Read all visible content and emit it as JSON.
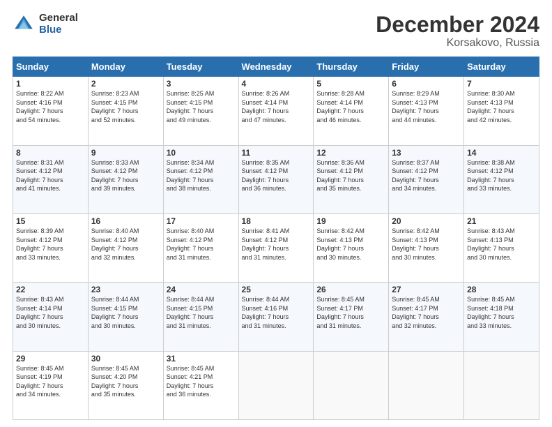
{
  "header": {
    "logo_general": "General",
    "logo_blue": "Blue",
    "main_title": "December 2024",
    "subtitle": "Korsakovo, Russia"
  },
  "days_of_week": [
    "Sunday",
    "Monday",
    "Tuesday",
    "Wednesday",
    "Thursday",
    "Friday",
    "Saturday"
  ],
  "weeks": [
    [
      {
        "day": "1",
        "sunrise": "8:22 AM",
        "sunset": "4:16 PM",
        "daylight_hours": "7",
        "daylight_minutes": "54"
      },
      {
        "day": "2",
        "sunrise": "8:23 AM",
        "sunset": "4:15 PM",
        "daylight_hours": "7",
        "daylight_minutes": "52"
      },
      {
        "day": "3",
        "sunrise": "8:25 AM",
        "sunset": "4:15 PM",
        "daylight_hours": "7",
        "daylight_minutes": "49"
      },
      {
        "day": "4",
        "sunrise": "8:26 AM",
        "sunset": "4:14 PM",
        "daylight_hours": "7",
        "daylight_minutes": "47"
      },
      {
        "day": "5",
        "sunrise": "8:28 AM",
        "sunset": "4:14 PM",
        "daylight_hours": "7",
        "daylight_minutes": "46"
      },
      {
        "day": "6",
        "sunrise": "8:29 AM",
        "sunset": "4:13 PM",
        "daylight_hours": "7",
        "daylight_minutes": "44"
      },
      {
        "day": "7",
        "sunrise": "8:30 AM",
        "sunset": "4:13 PM",
        "daylight_hours": "7",
        "daylight_minutes": "42"
      }
    ],
    [
      {
        "day": "8",
        "sunrise": "8:31 AM",
        "sunset": "4:12 PM",
        "daylight_hours": "7",
        "daylight_minutes": "41"
      },
      {
        "day": "9",
        "sunrise": "8:33 AM",
        "sunset": "4:12 PM",
        "daylight_hours": "7",
        "daylight_minutes": "39"
      },
      {
        "day": "10",
        "sunrise": "8:34 AM",
        "sunset": "4:12 PM",
        "daylight_hours": "7",
        "daylight_minutes": "38"
      },
      {
        "day": "11",
        "sunrise": "8:35 AM",
        "sunset": "4:12 PM",
        "daylight_hours": "7",
        "daylight_minutes": "36"
      },
      {
        "day": "12",
        "sunrise": "8:36 AM",
        "sunset": "4:12 PM",
        "daylight_hours": "7",
        "daylight_minutes": "35"
      },
      {
        "day": "13",
        "sunrise": "8:37 AM",
        "sunset": "4:12 PM",
        "daylight_hours": "7",
        "daylight_minutes": "34"
      },
      {
        "day": "14",
        "sunrise": "8:38 AM",
        "sunset": "4:12 PM",
        "daylight_hours": "7",
        "daylight_minutes": "33"
      }
    ],
    [
      {
        "day": "15",
        "sunrise": "8:39 AM",
        "sunset": "4:12 PM",
        "daylight_hours": "7",
        "daylight_minutes": "33"
      },
      {
        "day": "16",
        "sunrise": "8:40 AM",
        "sunset": "4:12 PM",
        "daylight_hours": "7",
        "daylight_minutes": "32"
      },
      {
        "day": "17",
        "sunrise": "8:40 AM",
        "sunset": "4:12 PM",
        "daylight_hours": "7",
        "daylight_minutes": "31"
      },
      {
        "day": "18",
        "sunrise": "8:41 AM",
        "sunset": "4:12 PM",
        "daylight_hours": "7",
        "daylight_minutes": "31"
      },
      {
        "day": "19",
        "sunrise": "8:42 AM",
        "sunset": "4:13 PM",
        "daylight_hours": "7",
        "daylight_minutes": "30"
      },
      {
        "day": "20",
        "sunrise": "8:42 AM",
        "sunset": "4:13 PM",
        "daylight_hours": "7",
        "daylight_minutes": "30"
      },
      {
        "day": "21",
        "sunrise": "8:43 AM",
        "sunset": "4:13 PM",
        "daylight_hours": "7",
        "daylight_minutes": "30"
      }
    ],
    [
      {
        "day": "22",
        "sunrise": "8:43 AM",
        "sunset": "4:14 PM",
        "daylight_hours": "7",
        "daylight_minutes": "30"
      },
      {
        "day": "23",
        "sunrise": "8:44 AM",
        "sunset": "4:15 PM",
        "daylight_hours": "7",
        "daylight_minutes": "30"
      },
      {
        "day": "24",
        "sunrise": "8:44 AM",
        "sunset": "4:15 PM",
        "daylight_hours": "7",
        "daylight_minutes": "31"
      },
      {
        "day": "25",
        "sunrise": "8:44 AM",
        "sunset": "4:16 PM",
        "daylight_hours": "7",
        "daylight_minutes": "31"
      },
      {
        "day": "26",
        "sunrise": "8:45 AM",
        "sunset": "4:17 PM",
        "daylight_hours": "7",
        "daylight_minutes": "31"
      },
      {
        "day": "27",
        "sunrise": "8:45 AM",
        "sunset": "4:17 PM",
        "daylight_hours": "7",
        "daylight_minutes": "32"
      },
      {
        "day": "28",
        "sunrise": "8:45 AM",
        "sunset": "4:18 PM",
        "daylight_hours": "7",
        "daylight_minutes": "33"
      }
    ],
    [
      {
        "day": "29",
        "sunrise": "8:45 AM",
        "sunset": "4:19 PM",
        "daylight_hours": "7",
        "daylight_minutes": "34"
      },
      {
        "day": "30",
        "sunrise": "8:45 AM",
        "sunset": "4:20 PM",
        "daylight_hours": "7",
        "daylight_minutes": "35"
      },
      {
        "day": "31",
        "sunrise": "8:45 AM",
        "sunset": "4:21 PM",
        "daylight_hours": "7",
        "daylight_minutes": "36"
      },
      null,
      null,
      null,
      null
    ]
  ],
  "labels": {
    "sunrise": "Sunrise:",
    "sunset": "Sunset:",
    "daylight": "Daylight: ",
    "hours": "hours",
    "and": "and",
    "minutes": "minutes."
  }
}
